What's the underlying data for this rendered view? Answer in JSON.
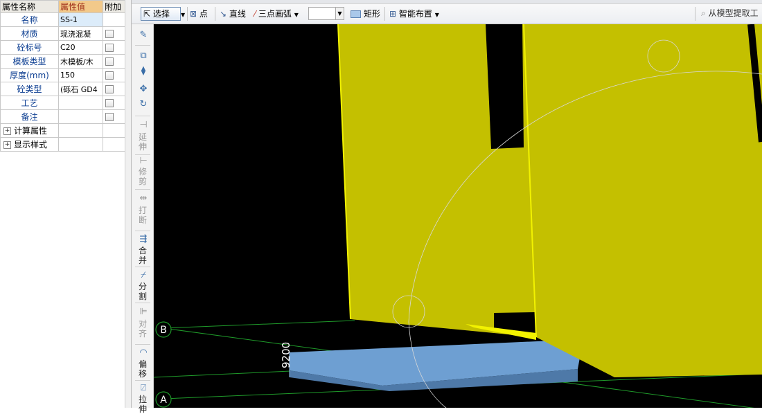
{
  "properties": {
    "headers": {
      "name": "属性名称",
      "value": "属性值",
      "extra": "附加"
    },
    "rows": [
      {
        "name": "名称",
        "value": "SS-1",
        "checkbox": false
      },
      {
        "name": "材质",
        "value": "现浇混凝",
        "checkbox": true
      },
      {
        "name": "砼标号",
        "value": "C20",
        "checkbox": true
      },
      {
        "name": "模板类型",
        "value": "木模板/木",
        "checkbox": true
      },
      {
        "name": "厚度(mm)",
        "value": "150",
        "checkbox": true
      },
      {
        "name": "砼类型",
        "value": "(砾石 GD4",
        "checkbox": true
      },
      {
        "name": "工艺",
        "value": "",
        "checkbox": true
      },
      {
        "name": "备注",
        "value": "",
        "checkbox": true
      }
    ],
    "groups": [
      {
        "expander": "+",
        "label": "计算属性"
      },
      {
        "expander": "+",
        "label": "显示样式"
      }
    ]
  },
  "toolbar": {
    "select_label": "选择",
    "point_label": "点",
    "line_label": "直线",
    "arc_label": "三点画弧",
    "arc_combo_value": "",
    "rect_label": "矩形",
    "smart_label": "智能布置",
    "extract_label": "从模型提取工"
  },
  "vtoolbar": {
    "extend": "延伸",
    "trim": "修剪",
    "break": "打断",
    "merge": "合并",
    "split": "分割",
    "align": "对齐",
    "offset": "偏移",
    "stretch": "拉伸"
  },
  "viewport": {
    "axis_b": "B",
    "axis_a": "A",
    "dimension": "9200",
    "colors": {
      "background": "#000000",
      "wall_fill": "#c4c000",
      "wall_edge": "#f2f200",
      "slab_top": "#6e9fd2",
      "slab_side": "#4e79a8",
      "grid_line": "#1f9a2a",
      "arc": "#d8d8d8"
    }
  },
  "icons": [
    "cursor-icon",
    "point-icon",
    "line-icon",
    "arc-icon",
    "rect-icon",
    "smart-layout-icon",
    "search-icon",
    "move-icon",
    "rotate-icon",
    "mirror-icon",
    "copy-icon",
    "edit-icon"
  ]
}
